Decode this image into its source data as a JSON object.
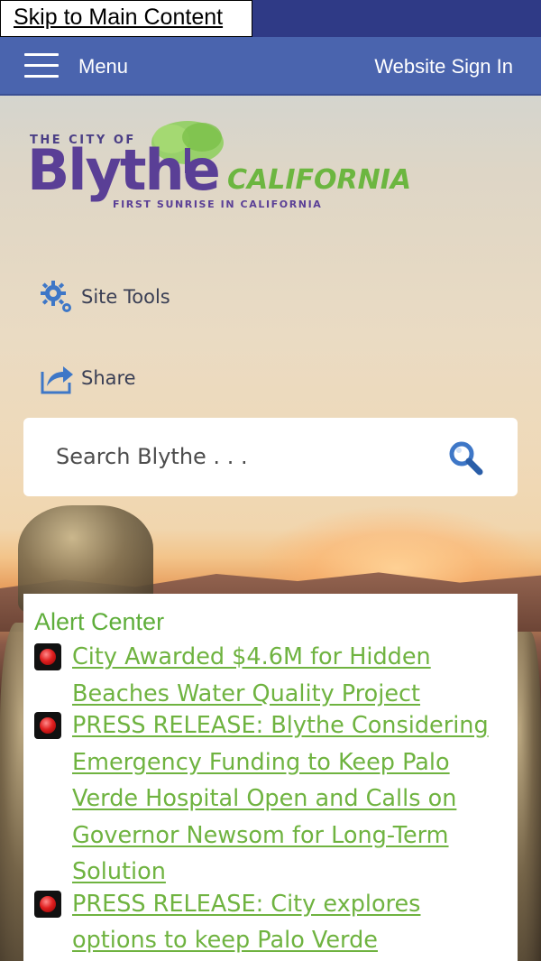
{
  "skip_link": {
    "label": "Skip to Main Content"
  },
  "nav": {
    "menu_label": "Menu",
    "signin_label": "Website Sign In"
  },
  "logo": {
    "the_city_of": "THE CITY OF",
    "city_name": "Blythe",
    "state": "CALIFORNIA",
    "tagline": "FIRST SUNRISE IN CALIFORNIA"
  },
  "tools": {
    "site_tools_label": "Site Tools",
    "share_label": "Share"
  },
  "search": {
    "placeholder": "Search Blythe . . ."
  },
  "alert_center": {
    "title": "Alert Center",
    "items": [
      {
        "text": "City Awarded $4.6M for Hidden Beaches Water Quality Project"
      },
      {
        "text": "PRESS RELEASE: Blythe Considering Emergency Funding to Keep Palo Verde Hospital Open and Calls on Governor Newsom for Long-Term Solution"
      },
      {
        "text": "PRESS RELEASE: City explores options to keep Palo Verde"
      }
    ]
  },
  "colors": {
    "skip_bar": "#2f3a86",
    "nav_bar": "#4a64ae",
    "brand_purple": "#5a3f96",
    "brand_green": "#6cb640",
    "alert_link": "#6fb340"
  },
  "icons": {
    "menu": "hamburger-icon",
    "site_tools": "gear-icon",
    "share": "share-icon",
    "search": "magnifier-icon",
    "alert": "red-alert-icon"
  }
}
